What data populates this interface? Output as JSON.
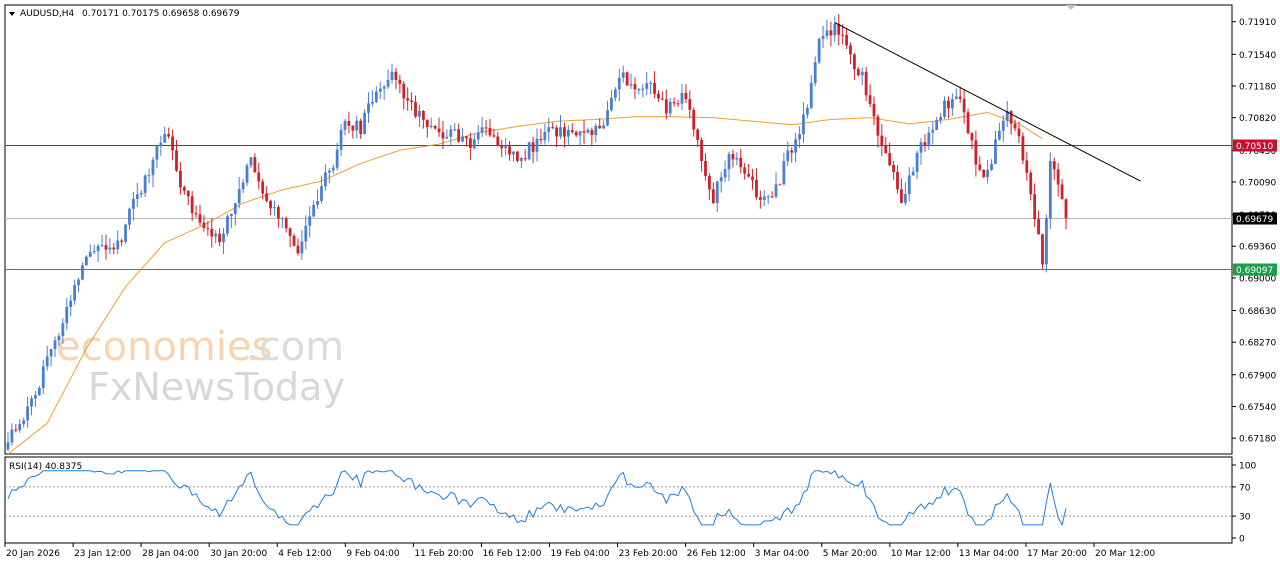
{
  "header": {
    "symbol": "AUDUSD,H4",
    "ohlc": "0.70171 0.70175 0.69658 0.69679"
  },
  "watermark": {
    "brand_a": "economies",
    "brand_b": ".com",
    "brand_c": "FxNewsToday"
  },
  "chart_data": {
    "type": "candlestick",
    "price_axis": {
      "range": [
        0.67,
        0.721
      ],
      "ticks": [
        "0.71910",
        "0.71540",
        "0.71180",
        "0.70820",
        "0.70450",
        "0.70090",
        "0.69720",
        "0.69360",
        "0.69000",
        "0.68630",
        "0.68270",
        "0.67900",
        "0.67540",
        "0.67180"
      ]
    },
    "time_axis": {
      "ticks": [
        "20 Jan 2026",
        "23 Jan 12:00",
        "28 Jan 04:00",
        "30 Jan 20:00",
        "4 Feb 12:00",
        "9 Feb 04:00",
        "11 Feb 20:00",
        "16 Feb 12:00",
        "19 Feb 04:00",
        "23 Feb 20:00",
        "26 Feb 12:00",
        "3 Mar 04:00",
        "5 Mar 20:00",
        "10 Mar 12:00",
        "13 Mar 04:00",
        "17 Mar 20:00",
        "20 Mar 12:00"
      ]
    },
    "levels": [
      {
        "label": "0.70510",
        "value": 0.7051,
        "color": "#c8102e"
      },
      {
        "label": "0.69679",
        "value": 0.69679,
        "color": "#000000"
      },
      {
        "label": "0.69097",
        "value": 0.69097,
        "color": "#1e9e4a"
      }
    ],
    "colors": {
      "bull": "#4a7fd0",
      "bear": "#d0202a",
      "ma": "#e8a030",
      "rsi": "#1f7fd4",
      "trend": "#000000"
    },
    "anchors": [
      [
        0,
        0.672
      ],
      [
        4,
        0.6745
      ],
      [
        8,
        0.678
      ],
      [
        12,
        0.683
      ],
      [
        15,
        0.686
      ],
      [
        19,
        0.692
      ],
      [
        23,
        0.693
      ],
      [
        28,
        0.6935
      ],
      [
        32,
        0.699
      ],
      [
        35,
        0.701
      ],
      [
        38,
        0.7045
      ],
      [
        40,
        0.707
      ],
      [
        44,
        0.7005
      ],
      [
        47,
        0.6975
      ],
      [
        51,
        0.696
      ],
      [
        54,
        0.694
      ],
      [
        58,
        0.699
      ],
      [
        62,
        0.703
      ],
      [
        66,
        0.699
      ],
      [
        70,
        0.696
      ],
      [
        74,
        0.693
      ],
      [
        78,
        0.6985
      ],
      [
        83,
        0.703
      ],
      [
        86,
        0.708
      ],
      [
        90,
        0.707
      ],
      [
        94,
        0.7115
      ],
      [
        98,
        0.7135
      ],
      [
        102,
        0.71
      ],
      [
        106,
        0.708
      ],
      [
        110,
        0.7065
      ],
      [
        114,
        0.7065
      ],
      [
        118,
        0.7055
      ],
      [
        122,
        0.707
      ],
      [
        126,
        0.705
      ],
      [
        130,
        0.7035
      ],
      [
        134,
        0.705
      ],
      [
        138,
        0.7075
      ],
      [
        142,
        0.706
      ],
      [
        147,
        0.706
      ],
      [
        152,
        0.708
      ],
      [
        156,
        0.713
      ],
      [
        160,
        0.7115
      ],
      [
        164,
        0.7125
      ],
      [
        168,
        0.709
      ],
      [
        172,
        0.711
      ],
      [
        176,
        0.706
      ],
      [
        178,
        0.701
      ],
      [
        180,
        0.699
      ],
      [
        184,
        0.704
      ],
      [
        188,
        0.702
      ],
      [
        192,
        0.699
      ],
      [
        196,
        0.7
      ],
      [
        200,
        0.705
      ],
      [
        204,
        0.709
      ],
      [
        207,
        0.7165
      ],
      [
        211,
        0.7185
      ],
      [
        214,
        0.716
      ],
      [
        218,
        0.713
      ],
      [
        221,
        0.708
      ],
      [
        225,
        0.7035
      ],
      [
        228,
        0.6985
      ],
      [
        232,
        0.704
      ],
      [
        236,
        0.7075
      ],
      [
        240,
        0.71
      ],
      [
        243,
        0.7105
      ],
      [
        246,
        0.705
      ],
      [
        249,
        0.701
      ],
      [
        252,
        0.705
      ],
      [
        255,
        0.7085
      ],
      [
        258,
        0.7055
      ],
      [
        262,
        0.697
      ],
      [
        264,
        0.692
      ],
      [
        266,
        0.703
      ],
      [
        268,
        0.7005
      ],
      [
        270,
        0.6968
      ]
    ],
    "trendline": {
      "from": [
        211,
        0.719
      ],
      "to": [
        289,
        0.701
      ]
    },
    "ma_anchors": [
      [
        0,
        0.67
      ],
      [
        10,
        0.6735
      ],
      [
        20,
        0.682
      ],
      [
        30,
        0.689
      ],
      [
        40,
        0.694
      ],
      [
        50,
        0.696
      ],
      [
        60,
        0.6985
      ],
      [
        70,
        0.7
      ],
      [
        80,
        0.701
      ],
      [
        90,
        0.703
      ],
      [
        100,
        0.7045
      ],
      [
        110,
        0.7052
      ],
      [
        120,
        0.7065
      ],
      [
        130,
        0.7072
      ],
      [
        140,
        0.7078
      ],
      [
        150,
        0.708
      ],
      [
        160,
        0.7083
      ],
      [
        170,
        0.7083
      ],
      [
        180,
        0.7082
      ],
      [
        190,
        0.7078
      ],
      [
        200,
        0.7074
      ],
      [
        210,
        0.708
      ],
      [
        220,
        0.7082
      ],
      [
        230,
        0.7075
      ],
      [
        240,
        0.708
      ],
      [
        250,
        0.7088
      ],
      [
        258,
        0.7075
      ],
      [
        264,
        0.7058
      ]
    ],
    "rsi": {
      "label": "RSI(14) 40.8375",
      "range": [
        0,
        100
      ],
      "ticks": [
        "100",
        "70",
        "30",
        "0"
      ],
      "levels": [
        30,
        70
      ]
    }
  }
}
